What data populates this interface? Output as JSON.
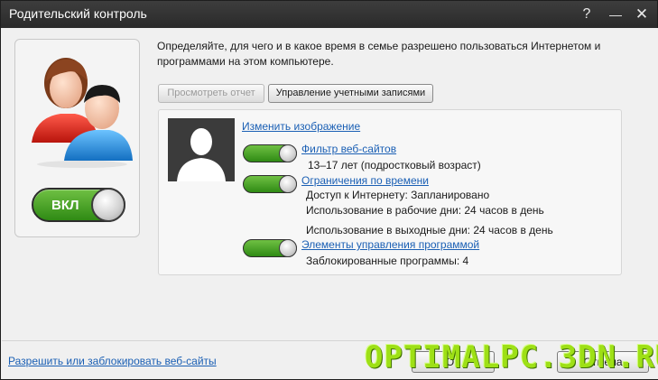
{
  "window": {
    "title": "Родительский контроль",
    "help_label": "?",
    "minimize_label": "—",
    "close_label": "✕"
  },
  "main_toggle": {
    "label": "ВКЛ",
    "state": "on"
  },
  "description": "Определяйте, для чего и в какое время в семье разрешено пользоваться Интернетом и программами на этом компьютере.",
  "toolbar": {
    "view_report": "Просмотреть отчет",
    "manage_accounts": "Управление учетными записями"
  },
  "profile": {
    "change_image": "Изменить изображение",
    "web_filter": {
      "label": "Фильтр веб-сайтов",
      "detail": "13–17 лет (подростковый возраст)"
    },
    "time_limits": {
      "label": "Ограничения по времени",
      "internet_access": "Доступ к Интернету: Запланировано",
      "weekdays": "Использование в рабочие дни:   24 часов в день",
      "weekends": "Использование в выходные дни:   24 часов в день"
    },
    "app_control": {
      "label": "Элементы управления программой",
      "blocked": "Заблокированные программы: 4"
    }
  },
  "footer": {
    "allow_block_link": "Разрешить или заблокировать веб-сайты",
    "ok_label": "ОК",
    "cancel_label": "Отмена"
  },
  "watermark": "OPTIMALPC.3DN.RU",
  "colors": {
    "toggle_green": "#3fa01f",
    "link_blue": "#1a5fb4",
    "watermark_green": "#9ee016"
  }
}
